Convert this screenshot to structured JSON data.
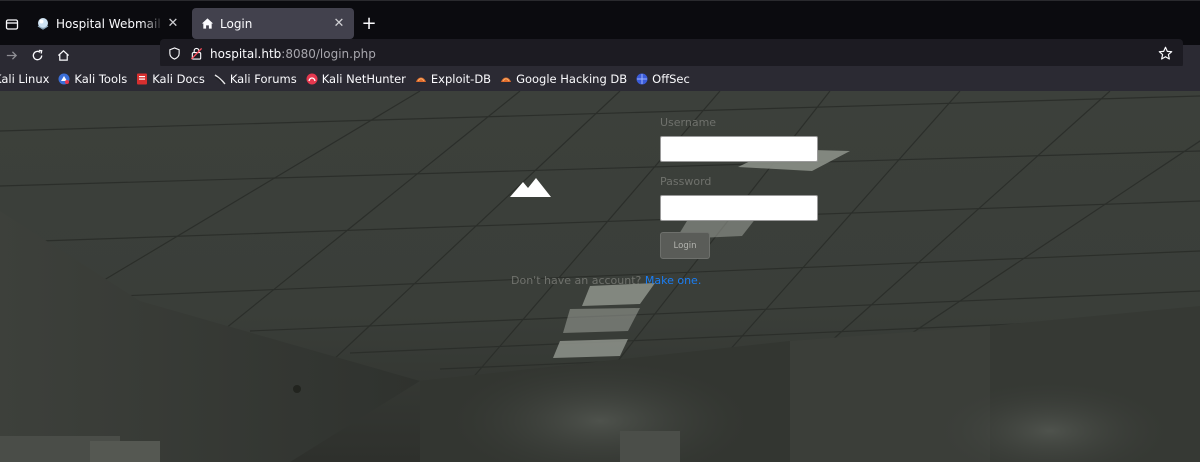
{
  "browser": {
    "tabs": [
      {
        "title": "Hospital Webmail :: Welcome",
        "icon": "roundcube-icon",
        "active": false
      },
      {
        "title": "Login",
        "icon": "home-icon",
        "active": true
      }
    ],
    "new_tab_label": "+",
    "close_glyph": "✕",
    "url": {
      "host": "hospital.htb",
      "rest": ":8080/login.php"
    },
    "bookmarks": [
      {
        "label": "Kali Linux",
        "icon": "kali-icon"
      },
      {
        "label": "Kali Tools",
        "icon": "kali-tools-icon"
      },
      {
        "label": "Kali Docs",
        "icon": "kali-docs-icon"
      },
      {
        "label": "Kali Forums",
        "icon": "kali-forums-icon"
      },
      {
        "label": "Kali NetHunter",
        "icon": "nethunter-icon"
      },
      {
        "label": "Exploit-DB",
        "icon": "exploit-db-icon"
      },
      {
        "label": "Google Hacking DB",
        "icon": "ghdb-icon"
      },
      {
        "label": "OffSec",
        "icon": "offsec-icon"
      }
    ]
  },
  "login": {
    "username_label": "Username",
    "username_value": "",
    "password_label": "Password",
    "password_value": "",
    "button_label": "Login",
    "signup_text": "Don't have an account?",
    "signup_link": "Make one."
  },
  "colors": {
    "link": "#1a7ef5",
    "background": "#3a3d39"
  }
}
